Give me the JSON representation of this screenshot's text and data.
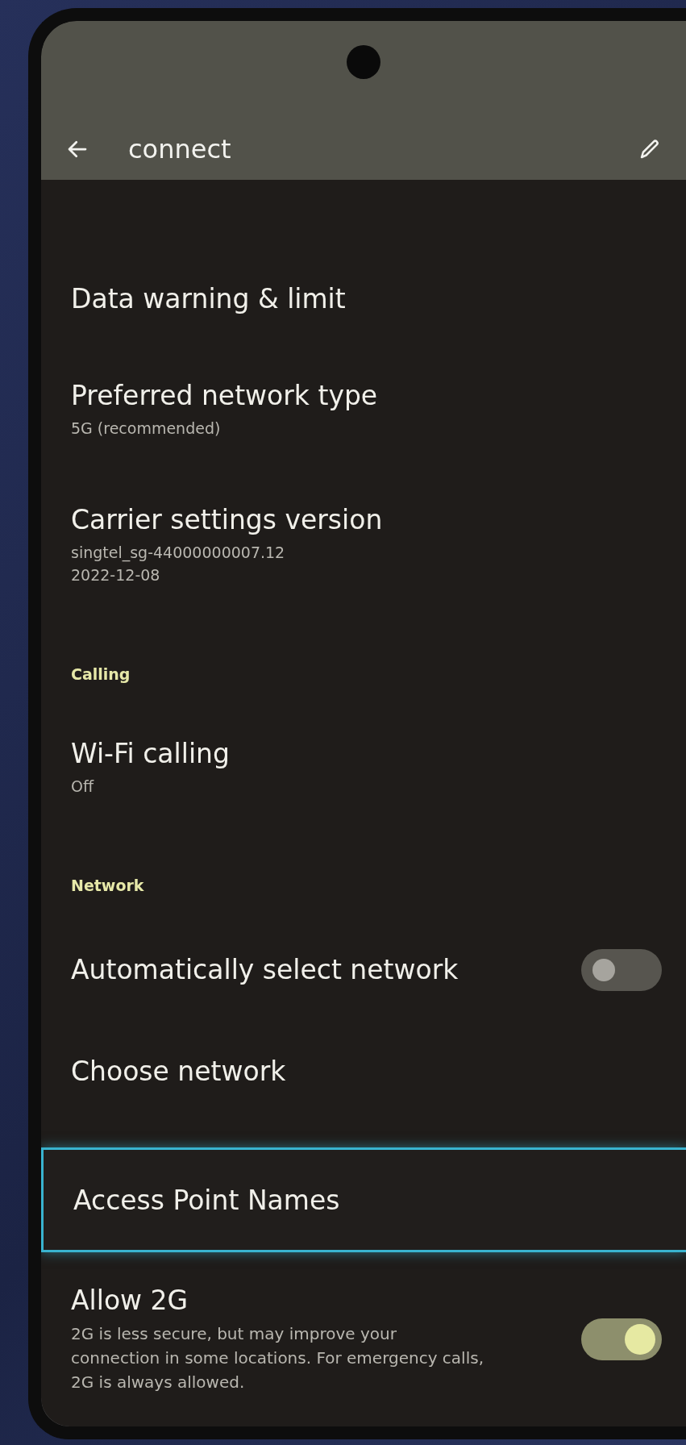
{
  "app_bar": {
    "title": "connect"
  },
  "items": [
    {
      "kind": "item",
      "title": "Data warning & limit",
      "highlighted": false
    },
    {
      "kind": "item",
      "title": "Preferred network type",
      "subtitle": "5G (recommended)",
      "highlighted": false
    },
    {
      "kind": "item",
      "title": "Carrier settings version",
      "subtitle": "singtel_sg-44000000007.12\n2022-12-08",
      "highlighted": false
    },
    {
      "kind": "header",
      "title": "Calling"
    },
    {
      "kind": "item",
      "title": "Wi-Fi calling",
      "subtitle": "Off",
      "highlighted": false
    },
    {
      "kind": "header",
      "title": "Network"
    },
    {
      "kind": "toggle",
      "title": "Automatically select network",
      "on": false,
      "highlighted": false
    },
    {
      "kind": "item",
      "title": "Choose network",
      "highlighted": false
    },
    {
      "kind": "item",
      "title": "Access Point Names",
      "highlighted": true
    },
    {
      "kind": "toggle",
      "title": "Allow 2G",
      "subtitle": "2G is less secure, but may improve your connection in some locations. For emergency calls, 2G is always allowed.",
      "on": true,
      "highlighted": false
    }
  ]
}
